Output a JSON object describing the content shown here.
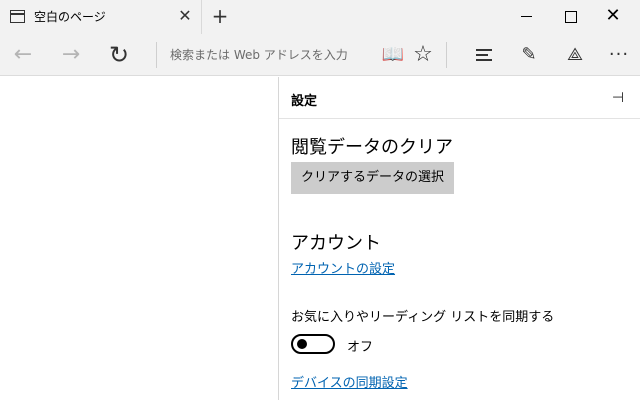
{
  "tab": {
    "title": "空白のページ",
    "icon": "page-icon",
    "close_icon": "close-icon"
  },
  "window_controls": [
    "minimize-icon",
    "maximize-icon",
    "close-icon"
  ],
  "toolbar": {
    "back_icon": "back-arrow-icon",
    "forward_icon": "forward-arrow-icon",
    "refresh_icon": "refresh-icon",
    "address_placeholder": "検索または Web アドレスを入力",
    "address_value": "",
    "right_icons": [
      "reading-view-icon",
      "favorite-star-icon",
      "hub-icon",
      "web-note-icon",
      "share-icon",
      "more-icon"
    ]
  },
  "settings": {
    "title": "設定",
    "pin_icon": "pin-icon",
    "clear_data": {
      "heading": "閲覧データのクリア",
      "button_label": "クリアするデータの選択"
    },
    "account": {
      "heading": "アカウント",
      "link_label": "アカウントの設定"
    },
    "sync": {
      "label": "お気に入りやリーディング リストを同期する",
      "toggle_state": "オフ",
      "toggle_on": false,
      "device_link_label": "デバイスの同期設定"
    }
  },
  "colors": {
    "chrome_bg": "#f2f2f2",
    "link": "#0063b1",
    "button_bg": "#cccccc"
  }
}
